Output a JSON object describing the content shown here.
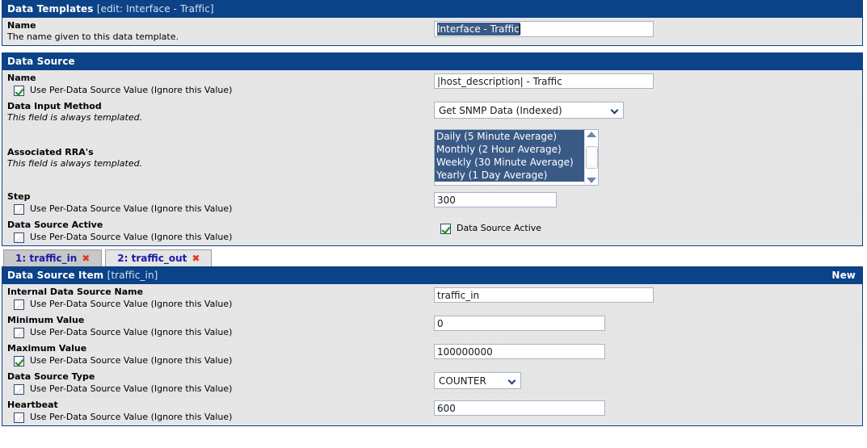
{
  "template_panel": {
    "header_title": "Data Templates",
    "header_sub": "[edit: Interface - Traffic]",
    "fields": [
      {
        "label": "Name",
        "desc": "The name given to this data template.",
        "desc_italic": false,
        "input_value": "Interface - Traffic",
        "input_selected": true,
        "input_width": 272
      }
    ]
  },
  "data_source_panel": {
    "header_title": "Data Source",
    "header_sub": "",
    "fields": [
      {
        "label": "Name",
        "checkbox_label": "Use Per-Data Source Value (Ignore this Value)",
        "checked": true,
        "input_value": "|host_description| - Traffic",
        "input_width": 272,
        "shaded": false
      },
      {
        "label": "Data Input Method",
        "desc": "This field is always templated.",
        "select_value": "Get SNMP Data (Indexed)",
        "select_width": 235,
        "shaded": true
      },
      {
        "label": "Associated RRA's",
        "desc": "This field is always templated.",
        "listbox_options": [
          "Daily (5 Minute Average)",
          "Monthly (2 Hour Average)",
          "Weekly (30 Minute Average)",
          "Yearly (1 Day Average)"
        ],
        "shaded": false
      },
      {
        "label": "Step",
        "checkbox_label": "Use Per-Data Source Value (Ignore this Value)",
        "checked": false,
        "input_value": "300",
        "input_width": 152,
        "shaded": true
      },
      {
        "label": "Data Source Active",
        "checkbox_label": "Use Per-Data Source Value (Ignore this Value)",
        "checked": false,
        "active_checkbox_label": "Data Source Active",
        "active_checked": true,
        "shaded": false
      }
    ]
  },
  "tabs": [
    {
      "label": "1: traffic_in",
      "close": "✖",
      "active": true
    },
    {
      "label": "2: traffic_out",
      "close": "✖",
      "active": false
    }
  ],
  "data_source_item_panel": {
    "header_title": "Data Source Item",
    "header_sub": "[traffic_in]",
    "new_label": "New",
    "fields": [
      {
        "label": "Internal Data Source Name",
        "checkbox_label": "Use Per-Data Source Value (Ignore this Value)",
        "checked": false,
        "input_value": "traffic_in",
        "input_width": 272,
        "shaded": false
      },
      {
        "label": "Minimum Value",
        "checkbox_label": "Use Per-Data Source Value (Ignore this Value)",
        "checked": false,
        "input_value": "0",
        "input_width": 212,
        "shaded": true
      },
      {
        "label": "Maximum Value",
        "checkbox_label": "Use Per-Data Source Value (Ignore this Value)",
        "checked": true,
        "input_value": "100000000",
        "input_width": 212,
        "shaded": false
      },
      {
        "label": "Data Source Type",
        "checkbox_label": "Use Per-Data Source Value (Ignore this Value)",
        "checked": false,
        "select_value": "COUNTER",
        "select_width": 108,
        "shaded": true
      },
      {
        "label": "Heartbeat",
        "checkbox_label": "Use Per-Data Source Value (Ignore this Value)",
        "checked": false,
        "input_value": "600",
        "input_width": 212,
        "shaded": false
      }
    ]
  },
  "colors": {
    "header_blue": "#0B4288",
    "border_blue": "#0A4282",
    "row_bg": "#E6E6E6",
    "select_highlight": "#3a5a86",
    "tab_link": "#1a1aa8",
    "close_red": "#e03a1e",
    "check_green": "#1f8a1f"
  }
}
